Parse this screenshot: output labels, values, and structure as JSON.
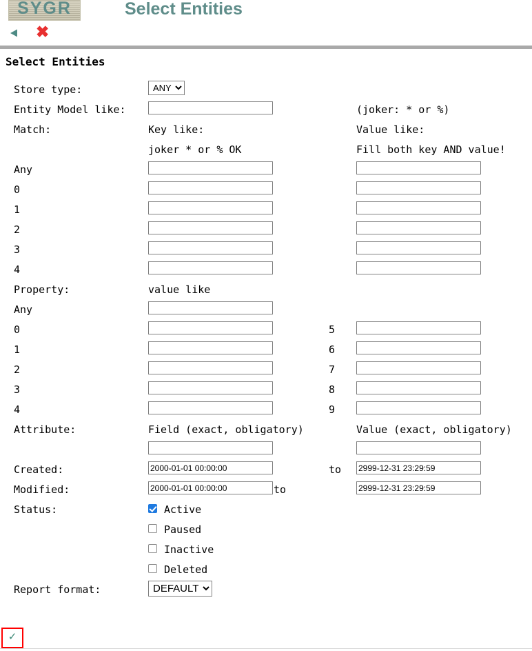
{
  "banner": {
    "logo_text": "SYGR",
    "title": "Select Entities"
  },
  "nav": {
    "back_icon": "back-triangle-icon",
    "close_icon": "close-x-icon"
  },
  "page": {
    "heading": "Select Entities"
  },
  "form": {
    "store_type": {
      "label": "Store type:",
      "value": "ANY",
      "options": [
        "ANY"
      ]
    },
    "entity_model": {
      "label": "Entity Model like:",
      "value": "",
      "hint": "(joker: * or %)"
    },
    "match": {
      "label": "Match:",
      "key_header": "Key like:",
      "value_header": "Value like:",
      "key_note": "joker * or % OK",
      "value_note": "Fill both key AND value!",
      "rows": [
        {
          "label": "Any",
          "key": "",
          "value": ""
        },
        {
          "label": "0",
          "key": "",
          "value": ""
        },
        {
          "label": "1",
          "key": "",
          "value": ""
        },
        {
          "label": "2",
          "key": "",
          "value": ""
        },
        {
          "label": "3",
          "key": "",
          "value": ""
        },
        {
          "label": "4",
          "key": "",
          "value": ""
        }
      ]
    },
    "property": {
      "label": "Property:",
      "header": "value like",
      "rows": [
        {
          "label": "Any",
          "value": "",
          "right_label": "",
          "right_value": null
        },
        {
          "label": "0",
          "value": "",
          "right_label": "5",
          "right_value": ""
        },
        {
          "label": "1",
          "value": "",
          "right_label": "6",
          "right_value": ""
        },
        {
          "label": "2",
          "value": "",
          "right_label": "7",
          "right_value": ""
        },
        {
          "label": "3",
          "value": "",
          "right_label": "8",
          "right_value": ""
        },
        {
          "label": "4",
          "value": "",
          "right_label": "9",
          "right_value": ""
        }
      ]
    },
    "attribute": {
      "label": "Attribute:",
      "field_header": "Field (exact, obligatory)",
      "value_header": "Value (exact, obligatory)",
      "field_value": "",
      "value_value": ""
    },
    "created": {
      "label": "Created:",
      "from": "2000-01-01 00:00:00",
      "to_label": "to",
      "to": "2999-12-31 23:29:59"
    },
    "modified": {
      "label": "Modified:",
      "from": "2000-01-01 00:00:00",
      "to_label": "to",
      "to": "2999-12-31 23:29:59"
    },
    "status": {
      "label": "Status:",
      "options": [
        {
          "label": "Active",
          "checked": true
        },
        {
          "label": "Paused",
          "checked": false
        },
        {
          "label": "Inactive",
          "checked": false
        },
        {
          "label": "Deleted",
          "checked": false
        }
      ]
    },
    "report_format": {
      "label": "Report format:",
      "value": "DEFAULT",
      "options": [
        "DEFAULT"
      ]
    },
    "submit": {
      "icon": "checkmark-icon",
      "glyph": "✓"
    }
  },
  "colors": {
    "brand_teal": "#5f8d8a",
    "close_red": "#e83030",
    "checkbox_blue": "#1f7ae0",
    "highlight_red": "#ff0000",
    "rule_gray": "#a9a9a9"
  }
}
